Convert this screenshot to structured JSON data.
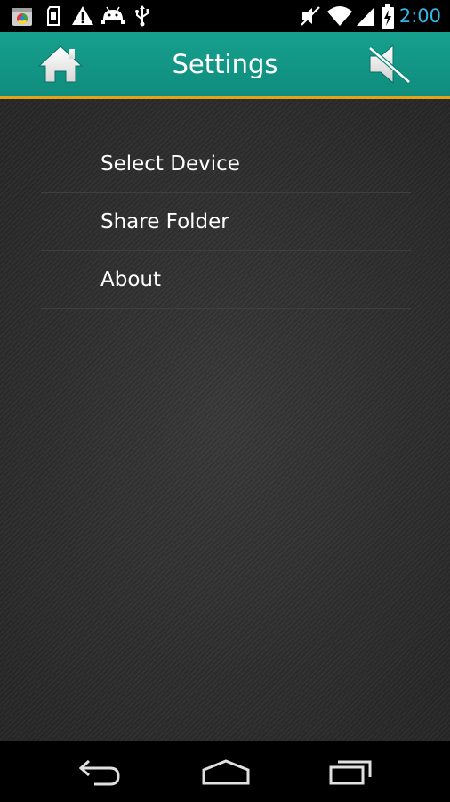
{
  "status_bar": {
    "time": "2:00",
    "icons": [
      "app-notification-icon",
      "sim-card-icon",
      "warning-icon",
      "android-debug-icon",
      "usb-icon",
      "mute-status-icon",
      "wifi-icon",
      "cell-signal-icon",
      "battery-charging-icon"
    ]
  },
  "title_bar": {
    "title": "Settings",
    "home_icon": "home-icon",
    "mute_icon": "volume-mute-icon",
    "accent_color": "#e0a41b",
    "bar_color": "#139585"
  },
  "menu": {
    "items": [
      {
        "label": "Select Device"
      },
      {
        "label": "Share Folder"
      },
      {
        "label": "About"
      }
    ]
  },
  "nav_bar": {
    "icons": [
      "back-icon",
      "home-nav-icon",
      "recents-icon"
    ]
  }
}
